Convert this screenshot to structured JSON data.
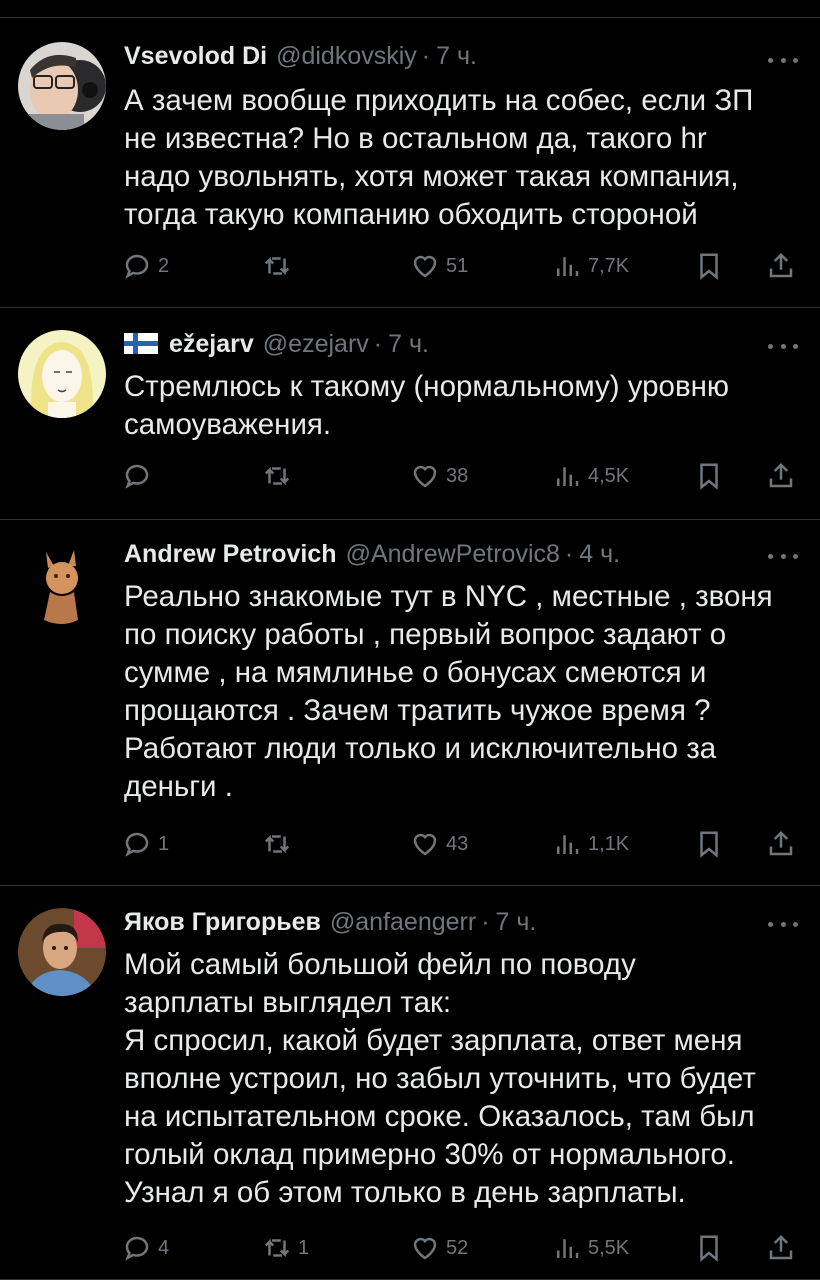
{
  "tweets": [
    {
      "name": "Vsevolod Di",
      "handle": "@didkovskiy",
      "dot": "·",
      "time": "7 ч.",
      "text": "А зачем вообще приходить на собес, если ЗП\nне известна? Но в остальном да,  такого hr\nнадо увольнять, хотя может такая компания,\nтогда такую компанию обходить стороной",
      "replies": "2",
      "retweets": "",
      "likes": "51",
      "views": "7,7K"
    },
    {
      "name": "ežejarv",
      "handle": "@ezejarv",
      "dot": "·",
      "time": "7 ч.",
      "text": "Стремлюсь к такому (нормальному) уровню\nсамоуважения.",
      "replies": "",
      "retweets": "",
      "likes": "38",
      "views": "4,5K"
    },
    {
      "name": "Andrew Petrovich",
      "handle": "@AndrewPetrovic8",
      "dot": "·",
      "time": "4 ч.",
      "text": "Реально знакомые тут в NYC , местные , звоня\nпо поиску работы , первый вопрос задают о\nсумме , на мямлинье о бонусах смеются и\nпрощаются . Зачем тратить чужое время ?\nРаботают люди только и исключительно за\nденьги .",
      "replies": "1",
      "retweets": "",
      "likes": "43",
      "views": "1,1K"
    },
    {
      "name": "Яков Григорьев",
      "handle": "@anfaengerr",
      "dot": "·",
      "time": "7 ч.",
      "text": "Мой самый большой фейл по поводу\nзарплаты выглядел так:\nЯ спросил, какой будет зарплата, ответ меня\nвполне устроил, но забыл уточнить, что будет\nна испытательном сроке. Оказалось, там был\nголый оклад примерно 30% от нормального.\nУзнал я об этом только в день зарплаты.",
      "replies": "4",
      "retweets": "1",
      "likes": "52",
      "views": "5,5K"
    }
  ],
  "icons": {
    "reply": "reply-icon",
    "retweet": "retweet-icon",
    "like": "heart-icon",
    "views": "views-icon",
    "bookmark": "bookmark-icon",
    "share": "share-icon",
    "more": "more-icon",
    "flag": "finland-flag-icon"
  },
  "colors": {
    "background": "#000000",
    "text": "#e7e9ea",
    "muted": "#71767b",
    "divider": "#2f3336"
  }
}
